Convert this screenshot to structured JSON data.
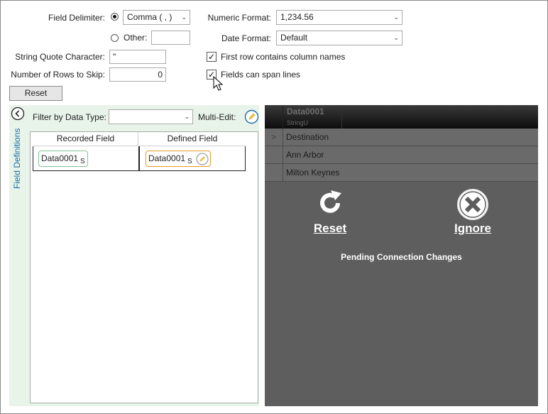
{
  "delimiter": {
    "label": "Field Delimiter:",
    "selected": "Comma ( , )",
    "other_label": "Other:",
    "other_value": ""
  },
  "numeric_format": {
    "label": "Numeric Format:",
    "value": "1,234.56"
  },
  "date_format": {
    "label": "Date Format:",
    "value": "Default"
  },
  "quote_char": {
    "label": "String Quote Character:",
    "value": "\""
  },
  "rows_to_skip": {
    "label": "Number of Rows to Skip:",
    "value": "0"
  },
  "first_row_names": {
    "label": "First row contains column names",
    "checked": true
  },
  "span_lines": {
    "label": "Fields can span lines",
    "checked": true
  },
  "reset_button": "Reset",
  "field_definitions": {
    "vertical_title": "Field Definitions",
    "filter_label": "Filter by Data Type:",
    "filter_value": "",
    "multi_edit_label": "Multi-Edit:",
    "columns": [
      "Recorded Field",
      "Defined Field"
    ],
    "rows": [
      {
        "recorded": "Data0001",
        "recorded_sub": "S",
        "defined": "Data0001",
        "defined_sub": "S"
      }
    ]
  },
  "preview": {
    "header_name": "Data0001",
    "header_type": "StringU",
    "row_marker": ">",
    "rows": [
      "Destination",
      "Ann Arbor",
      "Milton Keynes"
    ],
    "overlay": {
      "reset_label": "Reset",
      "ignore_label": "Ignore",
      "message": "Pending Connection Changes"
    }
  },
  "colors": {
    "panel_bg": "#e8f4ea",
    "recorded_chip": "#7fc49a",
    "defined_chip": "#e39a2a",
    "overlay_bg": "#5e5e5e"
  },
  "icons": [
    "collapse-left-icon",
    "pencil-icon",
    "refresh-icon",
    "close-icon",
    "mouse-cursor-icon"
  ]
}
